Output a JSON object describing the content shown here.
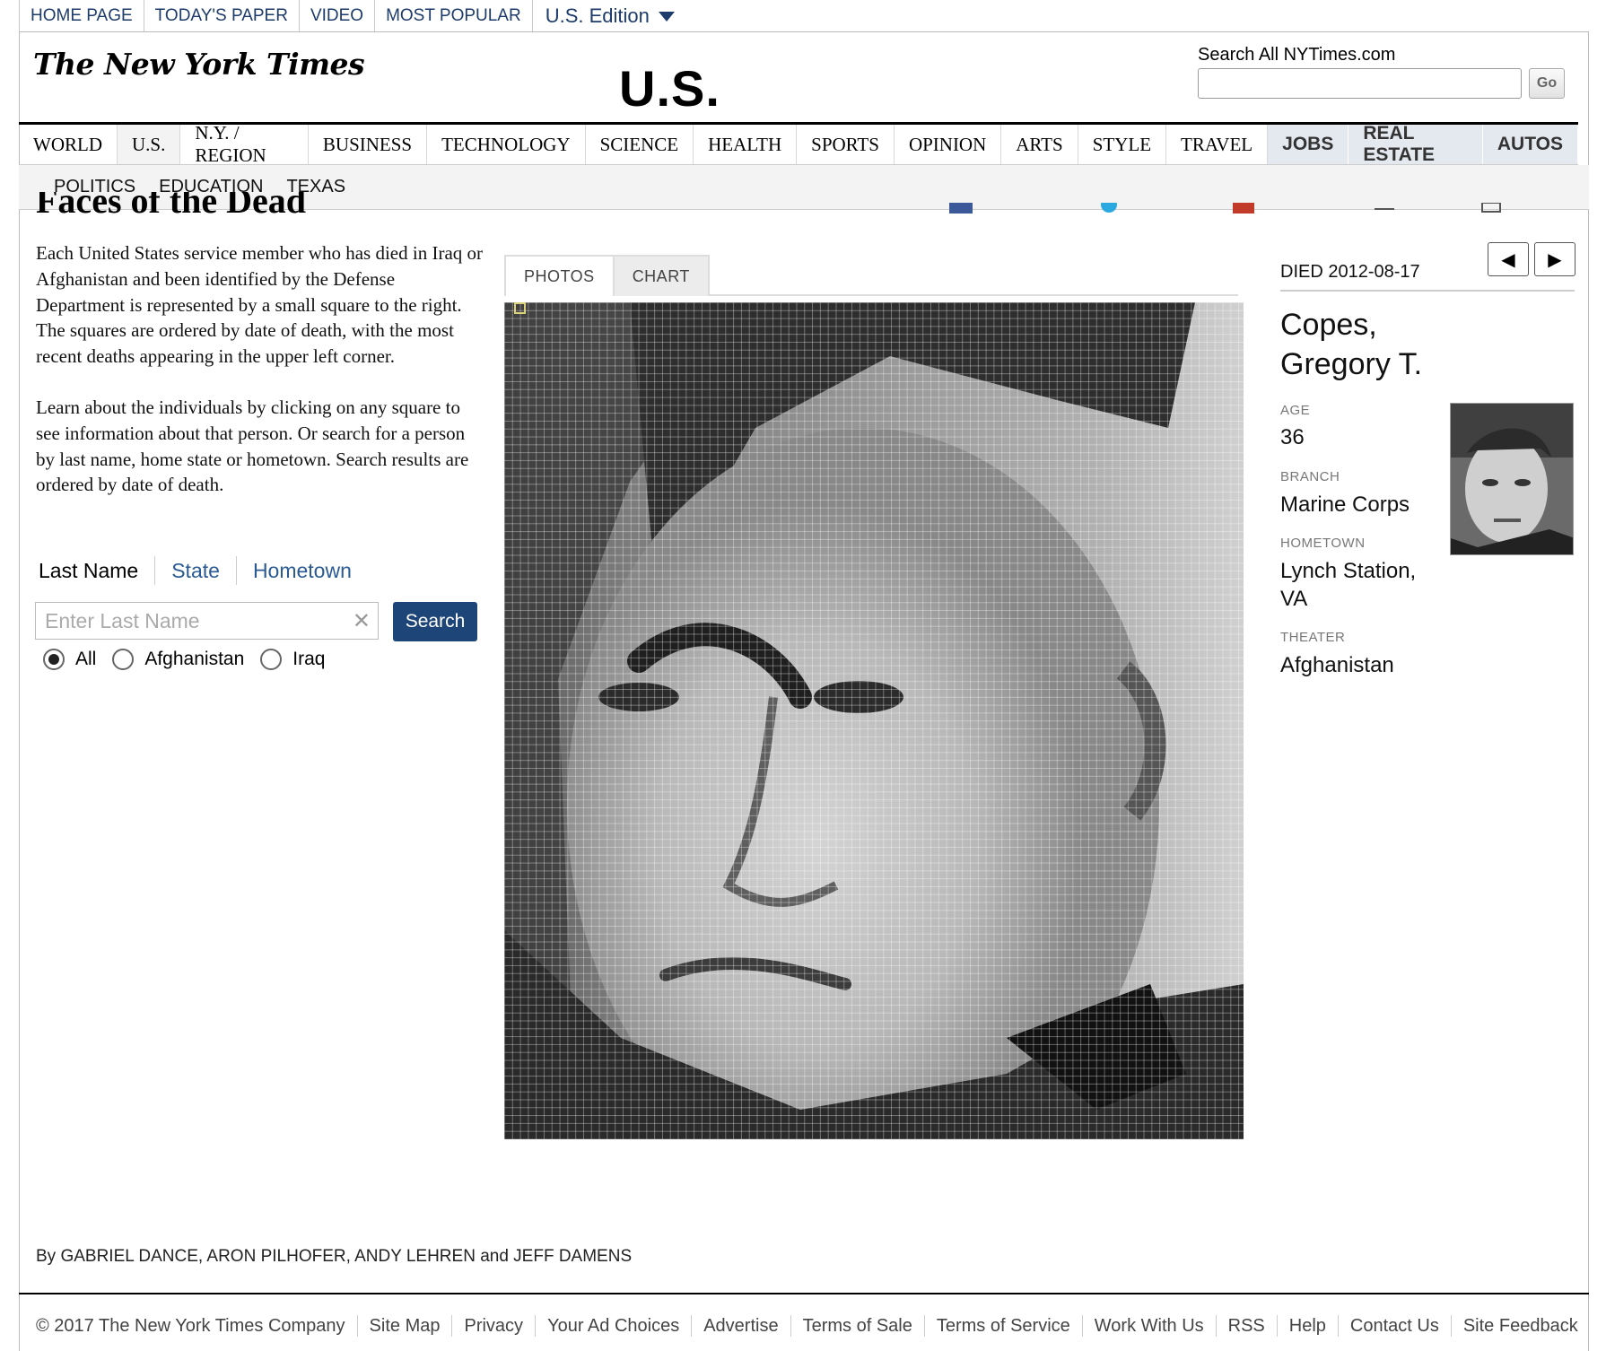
{
  "topbar": {
    "items": [
      "HOME PAGE",
      "TODAY'S PAPER",
      "VIDEO",
      "MOST POPULAR"
    ],
    "edition": "U.S. Edition"
  },
  "masthead": {
    "logo": "The New York Times",
    "section": "U.S.",
    "search_label": "Search All NYTimes.com",
    "go_label": "Go"
  },
  "nav": {
    "items": [
      "WORLD",
      "U.S.",
      "N.Y. / REGION",
      "BUSINESS",
      "TECHNOLOGY",
      "SCIENCE",
      "HEALTH",
      "SPORTS",
      "OPINION",
      "ARTS",
      "STYLE",
      "TRAVEL"
    ],
    "classifieds": [
      "JOBS",
      "REAL ESTATE",
      "AUTOS"
    ],
    "sub": [
      "POLITICS",
      "EDUCATION",
      "TEXAS"
    ]
  },
  "article": {
    "heading": "Faces of the Dead",
    "intro_p1": "Each United States service member who has died in Iraq or Afghanistan and been identified by the Defense Department is represented by a small square to the right. The squares are ordered by date of death, with the most recent deaths appearing in the upper left corner.",
    "intro_p2": "Learn about the individuals by clicking on any square to see information about that person.  Or search for a person by last name, home state or hometown. Search results are  ordered by date of death."
  },
  "search": {
    "tabs": [
      "Last Name",
      "State",
      "Hometown"
    ],
    "placeholder": "Enter Last Name",
    "button": "Search",
    "options": [
      "All",
      "Afghanistan",
      "Iraq"
    ],
    "selected": "All"
  },
  "viewer": {
    "tabs": [
      "PHOTOS",
      "CHART"
    ],
    "active_tab": "PHOTOS"
  },
  "person": {
    "died": "DIED 2012-08-17",
    "name_line1": "Copes,",
    "name_line2": "Gregory T.",
    "age_label": "AGE",
    "age": "36",
    "branch_label": "BRANCH",
    "branch": "Marine Corps",
    "hometown_label": "HOMETOWN",
    "hometown_line1": "Lynch Station,",
    "hometown_line2": "VA",
    "theater_label": "THEATER",
    "theater": "Afghanistan"
  },
  "byline": "By GABRIEL DANCE, ARON PILHOFER, ANDY LEHREN and JEFF DAMENS",
  "footer": [
    "© 2017 The New York Times Company",
    "Site Map",
    "Privacy",
    "Your Ad Choices",
    "Advertise",
    "Terms of Sale",
    "Terms of Service",
    "Work With Us",
    "RSS",
    "Help",
    "Contact Us",
    "Site Feedback"
  ],
  "colors": {
    "nav_link": "#1d3b6b",
    "search_button": "#1e4577",
    "link": "#2a5a93"
  }
}
